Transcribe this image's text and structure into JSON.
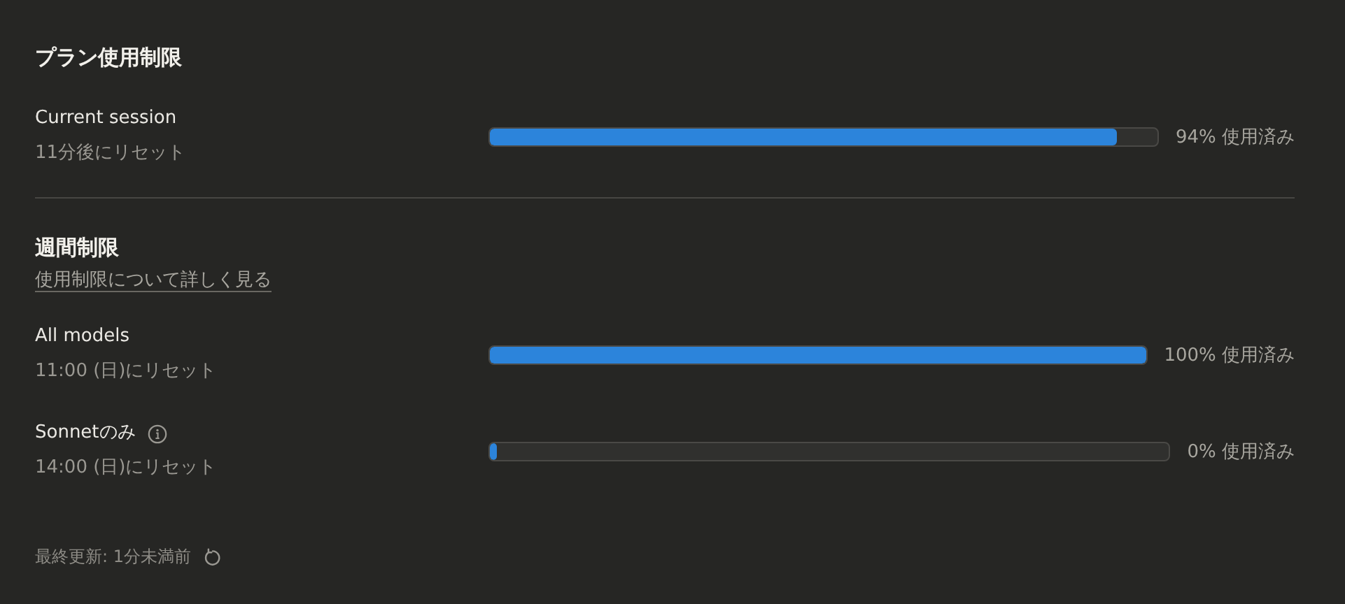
{
  "plan_section": {
    "title": "プラン使用制限",
    "rows": [
      {
        "label": "Current session",
        "info": false,
        "reset": "11分後にリセット",
        "level": 0.94,
        "reading": "94% 使用済み"
      }
    ]
  },
  "weekly_section": {
    "title": "週間制限",
    "link": "使用制限について詳しく見る",
    "rows": [
      {
        "label": "All models",
        "info": false,
        "reset": "11:00 (日)にリセット",
        "level": 1,
        "reading": "100% 使用済み"
      },
      {
        "label": "Sonnetのみ",
        "info": true,
        "reset": "14:00 (日)にリセット",
        "level": 0,
        "reading": "0% 使用済み"
      }
    ]
  },
  "footer": {
    "updated": "最終更新: 1分未満前"
  }
}
